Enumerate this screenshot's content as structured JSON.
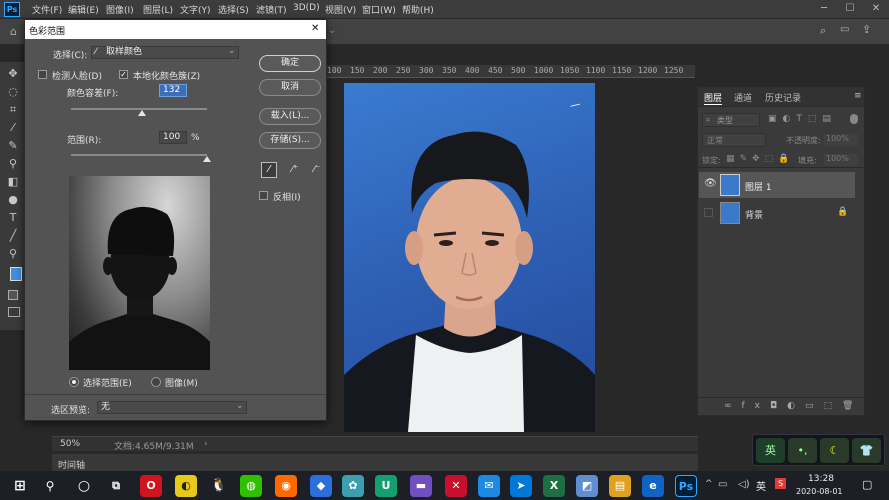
{
  "app": {
    "logo": "Ps"
  },
  "menu": [
    {
      "label": "文件(F)"
    },
    {
      "label": "编辑(E)"
    },
    {
      "label": "图像(I)"
    },
    {
      "label": "图层(L)"
    },
    {
      "label": "文字(Y)"
    },
    {
      "label": "选择(S)"
    },
    {
      "label": "滤镜(T)"
    },
    {
      "label": "3D(D)"
    },
    {
      "label": "视图(V)"
    },
    {
      "label": "窗口(W)"
    },
    {
      "label": "帮助(H)"
    }
  ],
  "ruler": {
    "labels": [
      "100",
      "150",
      "200",
      "250",
      "300",
      "350",
      "400",
      "450",
      "500",
      "1000",
      "1050",
      "1100",
      "1150",
      "1200",
      "1250",
      "1300"
    ]
  },
  "dialog": {
    "title": "色彩范围",
    "select_label": "选择(C):",
    "select_value": "取样颜色",
    "detect_faces": "检测人脸(D)",
    "localized": "本地化颜色簇(Z)",
    "fuzziness_label": "颜色容差(F):",
    "fuzziness_value": "132",
    "range_label": "范围(R):",
    "range_value": "100",
    "range_unit": "%",
    "ok": "确定",
    "cancel": "取消",
    "load": "载入(L)...",
    "save": "存储(S)...",
    "invert": "反相(I)",
    "radio_selection": "选择范围(E)",
    "radio_image": "图像(M)",
    "preview_label": "选区预览:",
    "preview_value": "无",
    "localized_checked": true,
    "fuzziness_level": 0.52,
    "range_level": 1.0
  },
  "status": {
    "zoom": "50%",
    "doc": "文档:4.65M/9.31M"
  },
  "timeline": {
    "label": "时间轴"
  },
  "panel": {
    "tabs": [
      "图层",
      "通道",
      "历史记录"
    ],
    "search_placeholder": "类型",
    "blend": "正常",
    "opacity_label": "不透明度:",
    "opacity": "100%",
    "lock_label": "锁定:",
    "fill_label": "填充:",
    "fill": "100%",
    "layers": [
      {
        "name": "图层 1",
        "visible": true,
        "selected": true
      },
      {
        "name": "背景",
        "locked": true
      }
    ]
  },
  "ime": {
    "lang": "英"
  },
  "taskbar": {
    "lang": "英",
    "time": "13:28",
    "date": "2020-08-01"
  }
}
